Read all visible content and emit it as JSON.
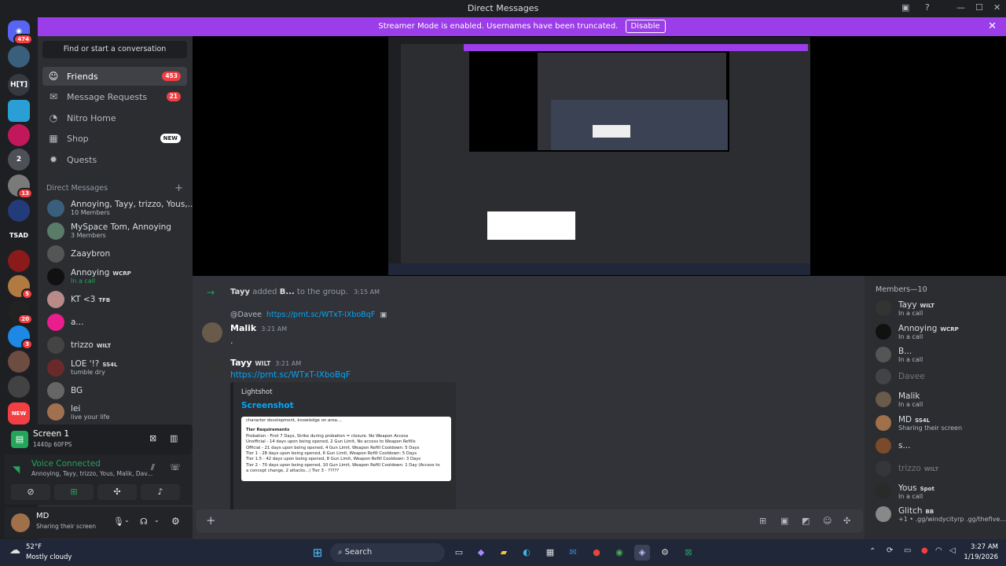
{
  "window": {
    "title": "Direct Messages"
  },
  "streamer": {
    "text": "Streamer Mode is enabled. Usernames have been truncated.",
    "disable": "Disable"
  },
  "guilds": {
    "home_badge": "474",
    "items": [
      {
        "label": "H[T]"
      },
      {
        "label": "2"
      },
      {
        "label": "13"
      },
      {
        "label": "TSAD"
      },
      {
        "label": "5"
      },
      {
        "label": "20"
      },
      {
        "label": "3"
      },
      {
        "label": "NEW"
      }
    ]
  },
  "sidebar": {
    "find": "Find or start a conversation",
    "nav": [
      {
        "label": "Friends",
        "count": "453"
      },
      {
        "label": "Message Requests",
        "count": "21"
      },
      {
        "label": "Nitro Home"
      },
      {
        "label": "Shop",
        "new": "NEW"
      },
      {
        "label": "Quests"
      }
    ],
    "dm_header": "Direct Messages",
    "dms": [
      {
        "name": "Annoying, Tayy, trizzo, Yous,...",
        "sub": "10 Members"
      },
      {
        "name": "MySpace Tom, Annoying",
        "sub": "3 Members"
      },
      {
        "name": "Zaaybron",
        "sub": ""
      },
      {
        "name": "Annoying",
        "tag": "WCRP",
        "sub": "In a call"
      },
      {
        "name": "KT <3",
        "tag": "TFB",
        "sub": ""
      },
      {
        "name": "a...",
        "sub": ""
      },
      {
        "name": "trizzo",
        "tag": "WILT",
        "sub": ""
      },
      {
        "name": "LOE '!?",
        "tag": "SS4L",
        "sub": "tumble dry"
      },
      {
        "name": "BG",
        "sub": ""
      },
      {
        "name": "lei",
        "sub": "live your life"
      }
    ],
    "screen": {
      "title": "Screen 1",
      "quality": "1440p 60FPS"
    },
    "voice": {
      "status": "Voice Connected",
      "members": "Annoying, Tayy, trizzo, Yous, Malik, Dav..."
    },
    "user": {
      "name": "MD",
      "status": "Sharing their screen"
    }
  },
  "messages": {
    "system": {
      "actor": "Tayy",
      "text": " added ",
      "target": "B...",
      "rest": " to the group.",
      "time": "3:15 AM"
    },
    "reply": {
      "mention": "@Davee",
      "link": "https://prnt.sc/WTxT-IXboBqF"
    },
    "malik": {
      "name": "Malik",
      "time": "3:21 AM",
      "text": "."
    },
    "tayy": {
      "name": "Tayy",
      "tag": "WILT",
      "time": "3:21 AM",
      "link": "https://prnt.sc/WTxT-IXboBqF"
    },
    "embed": {
      "provider": "Lightshot",
      "title": "Screenshot",
      "lines": [
        "character development, knowledge on area....",
        "Tier Requirements",
        "Probation - First 7 Days, Strike during probation = closure. No Weapon Access",
        "Unofficial - 14 days upon being opened, 2 Gun Limit, No access to Weapon Refills",
        "Official - 21 days upon being opened, 4 Gun Limit, Weapon Refill Cooldown: 5 Days",
        "Tier 1 - 28 days upon being opened, 6 Gun Limit, Weapon Refill Cooldown: 5 Days",
        "Tier 1.5 - 42 days upon being opened, 8 Gun Limit, Weapon Refill Cooldown: 3 Days",
        "Tier 2 - 70 days upon being opened, 10 Gun Limit, Weapon Refill Cooldown: 1 Day (Access to",
        "a concept change, 2 attacks...) Tier 3 - ?????"
      ]
    }
  },
  "members": {
    "header": "Members—10",
    "list": [
      {
        "name": "Tayy",
        "tag": "WILT",
        "status": "In a call"
      },
      {
        "name": "Annoying",
        "tag": "WCRP",
        "status": "In a call"
      },
      {
        "name": "B...",
        "status": "In a call"
      },
      {
        "name": "Davee",
        "status": ""
      },
      {
        "name": "Malik",
        "status": "In a call"
      },
      {
        "name": "MD",
        "tag": "SS4L",
        "status": "Sharing their screen"
      },
      {
        "name": "s...",
        "status": ""
      },
      {
        "name": "trizzo",
        "tag": "WILT",
        "status": ""
      },
      {
        "name": "Yous",
        "tag": "Spot",
        "status": "In a call"
      },
      {
        "name": "Glitch",
        "tag": "BB",
        "status": "+1 • .gg/windycityrp .gg/thefive..."
      }
    ]
  },
  "taskbar": {
    "weather_temp": "52°F",
    "weather_desc": "Mostly cloudy",
    "search": "Search",
    "time": "3:27 AM",
    "date": "1/19/2026"
  },
  "colors": {
    "accent": "#5865f2",
    "streamer": "#9b3de8",
    "link": "#00a8fc",
    "green": "#23a55a",
    "red": "#f23f43"
  }
}
